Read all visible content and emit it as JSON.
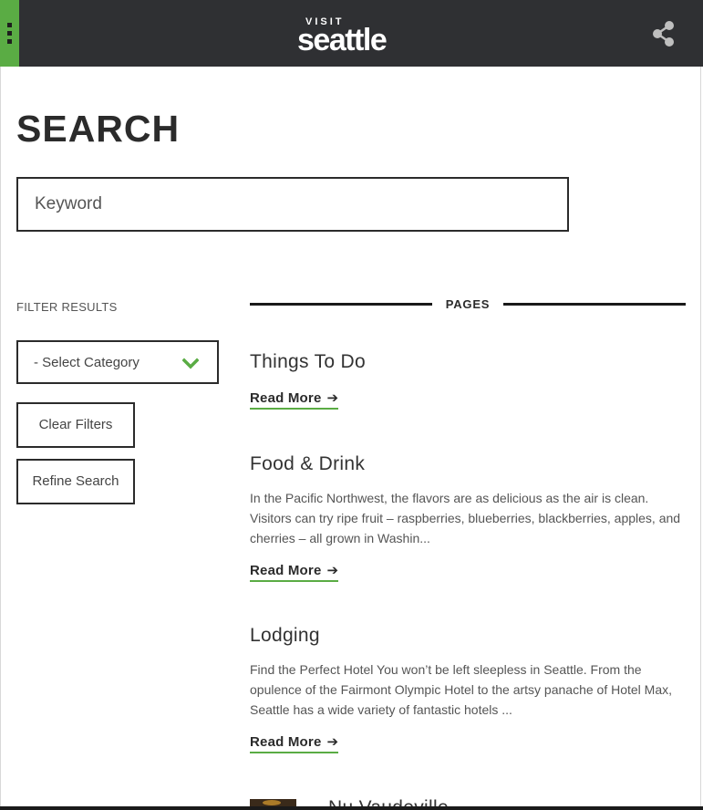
{
  "header": {
    "logo_small": "VISIT",
    "logo_main": "seattle",
    "menu_icon": "menu-dots-icon",
    "share_icon": "share-icon",
    "brand_color": "#5aac44",
    "bar_color": "#2f3033"
  },
  "page": {
    "title": "SEARCH"
  },
  "search": {
    "placeholder": "Keyword",
    "value": ""
  },
  "filters": {
    "label": "FILTER RESULTS",
    "category_select": "- Select Category",
    "clear_label": "Clear Filters",
    "refine_label": "Refine Search"
  },
  "results": {
    "section_label": "PAGES",
    "read_more_label": "Read More",
    "items": [
      {
        "title": "Things To Do",
        "description": ""
      },
      {
        "title": "Food & Drink",
        "description": "In the Pacific Northwest, the flavors are as delicious as the air is clean. Visitors can try ripe fruit – raspberries, blueberries, blackberries, apples, and cherries – all grown in Washin..."
      },
      {
        "title": "Lodging",
        "description": "Find the Perfect Hotel You won’t be left sleepless in Seattle. From the opulence of the Fairmont Olympic Hotel to the artsy panache of Hotel Max, Seattle has a wide variety of fantastic hotels ..."
      },
      {
        "title": "Nu Vaudeville",
        "description": ""
      }
    ]
  }
}
